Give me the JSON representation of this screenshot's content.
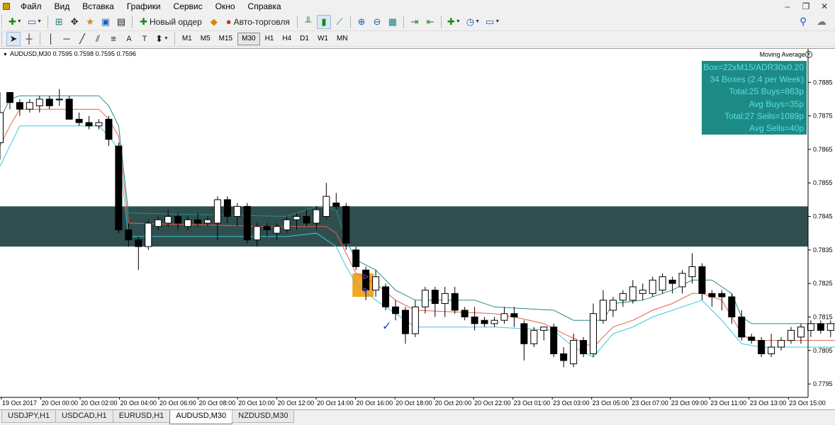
{
  "menu": {
    "items": [
      {
        "label": "Файл",
        "name": "menu-file"
      },
      {
        "label": "Вид",
        "name": "menu-view"
      },
      {
        "label": "Вставка",
        "name": "menu-insert"
      },
      {
        "label": "Графики",
        "name": "menu-charts"
      },
      {
        "label": "Сервис",
        "name": "menu-tools"
      },
      {
        "label": "Окно",
        "name": "menu-window"
      },
      {
        "label": "Справка",
        "name": "menu-help"
      }
    ],
    "window_controls": {
      "minimize": "–",
      "restore": "❐",
      "close": "✕"
    }
  },
  "toolbar": {
    "new_order_label": "Новый ордер",
    "autotrading_label": "Авто-торговля",
    "timeframes": [
      "M1",
      "M5",
      "M15",
      "M30",
      "H1",
      "H4",
      "D1",
      "W1",
      "MN"
    ],
    "active_timeframe": "M30",
    "icons": {
      "new_chart": "new-chart-icon",
      "profiles": "profiles-icon",
      "market_watch": "market-watch-icon",
      "data_window": "data-window-icon",
      "navigator": "navigator-icon",
      "terminal": "terminal-icon",
      "tester": "strategy-tester-icon",
      "bar_chart": "bar-chart-icon",
      "candles": "candlestick-chart-icon",
      "line_chart": "line-chart-icon",
      "zoom_in": "zoom-in-icon",
      "zoom_out": "zoom-out-icon",
      "tile": "tile-windows-icon",
      "autoscroll": "autoscroll-icon",
      "shift": "chart-shift-icon",
      "indicators": "indicators-icon",
      "periods": "periods-clock-icon",
      "templates": "templates-icon",
      "cursor": "cursor-icon",
      "crosshair": "crosshair-icon",
      "vline": "vertical-line-icon",
      "hline": "horizontal-line-icon",
      "trendline": "trendline-icon",
      "equidistant": "equidistant-channel-icon",
      "fibo": "fibonacci-icon",
      "text": "text-icon",
      "label": "text-label-icon",
      "arrows": "arrows-icon",
      "search": "search-icon",
      "community": "community-icon"
    }
  },
  "chart": {
    "symbol_info": "AUDUSD,M30  0.7595 0.7598 0.7595 0.7596",
    "indicator_name": "Moving Average",
    "stats": [
      "Box=22xM15/ADR30x0.20",
      "34 Boxes (2.4 per Week)",
      "Total:25 Buys=863p",
      "Avg Buys=35p",
      "Total:27 Sells=1089p",
      "Avg Sells=40p"
    ],
    "price_labels": [
      "0.7885",
      "0.7875",
      "0.7865",
      "0.7855",
      "0.7845",
      "0.7835",
      "0.7825",
      "0.7815",
      "0.7805",
      "0.7795"
    ],
    "time_labels": [
      "19 Oct 2017",
      "20 Oct 00:00",
      "20 Oct 02:00",
      "20 Oct 04:00",
      "20 Oct 06:00",
      "20 Oct 08:00",
      "20 Oct 10:00",
      "20 Oct 12:00",
      "20 Oct 14:00",
      "20 Oct 16:00",
      "20 Oct 18:00",
      "20 Oct 20:00",
      "20 Oct 22:00",
      "23 Oct 01:00",
      "23 Oct 03:00",
      "23 Oct 05:00",
      "23 Oct 07:00",
      "23 Oct 09:00",
      "23 Oct 11:00",
      "23 Oct 13:00",
      "23 Oct 15:00"
    ],
    "colors": {
      "background": "#ffffff",
      "box_fill": "#2f4f4f",
      "bear_candle": "#000000",
      "bull_candle": "#ffffff",
      "ma_mid": "#e8604a",
      "ma_upper": "#2a8a8a",
      "ma_lower": "#3cc8d8",
      "signal_box": "#f5a623",
      "checkmark": "#1a3fd0",
      "stats_bg": "#1e8a86",
      "stats_text": "#55e0e4"
    }
  },
  "chart_data": {
    "type": "candlestick",
    "series_kind": "ohlc",
    "yrange": [
      0.7791,
      0.7895
    ],
    "box": {
      "low": 0.7836,
      "high": 0.7848
    },
    "candles": [
      [
        0.7867,
        0.7882,
        0.7862,
        0.7876
      ],
      [
        0.7882,
        0.7882,
        0.7877,
        0.7879
      ],
      [
        0.7879,
        0.788,
        0.7875,
        0.7877
      ],
      [
        0.7877,
        0.788,
        0.7876,
        0.7879
      ],
      [
        0.7878,
        0.7881,
        0.7876,
        0.788
      ],
      [
        0.788,
        0.7881,
        0.7877,
        0.7878
      ],
      [
        0.788,
        0.7883,
        0.7878,
        0.788
      ],
      [
        0.788,
        0.7881,
        0.7874,
        0.7874
      ],
      [
        0.7874,
        0.7876,
        0.7872,
        0.7873
      ],
      [
        0.7873,
        0.7875,
        0.7871,
        0.7872
      ],
      [
        0.7872,
        0.7874,
        0.7871,
        0.7873
      ],
      [
        0.7874,
        0.7875,
        0.7866,
        0.7868
      ],
      [
        0.7866,
        0.7867,
        0.784,
        0.7841
      ],
      [
        0.7841,
        0.7843,
        0.7836,
        0.7838
      ],
      [
        0.7838,
        0.7839,
        0.7829,
        0.7836
      ],
      [
        0.7836,
        0.7844,
        0.7835,
        0.7843
      ],
      [
        0.7842,
        0.7845,
        0.7841,
        0.7844
      ],
      [
        0.7843,
        0.7847,
        0.7842,
        0.7845
      ],
      [
        0.7845,
        0.7846,
        0.7841,
        0.7843
      ],
      [
        0.7842,
        0.7845,
        0.7841,
        0.7844
      ],
      [
        0.7844,
        0.7846,
        0.7842,
        0.7843
      ],
      [
        0.7843,
        0.7845,
        0.7842,
        0.7844
      ],
      [
        0.7843,
        0.7851,
        0.7838,
        0.785
      ],
      [
        0.785,
        0.7851,
        0.7843,
        0.7845
      ],
      [
        0.7845,
        0.7849,
        0.7842,
        0.7848
      ],
      [
        0.7848,
        0.7849,
        0.7837,
        0.7838
      ],
      [
        0.7838,
        0.7843,
        0.7836,
        0.7842
      ],
      [
        0.7842,
        0.7843,
        0.7839,
        0.7841
      ],
      [
        0.784,
        0.7843,
        0.7838,
        0.7842
      ],
      [
        0.7841,
        0.7845,
        0.784,
        0.7844
      ],
      [
        0.7844,
        0.7846,
        0.7841,
        0.7845
      ],
      [
        0.7845,
        0.7847,
        0.7842,
        0.7843
      ],
      [
        0.7843,
        0.7848,
        0.7841,
        0.7847
      ],
      [
        0.7845,
        0.7855,
        0.7844,
        0.7851
      ],
      [
        0.7849,
        0.7852,
        0.7847,
        0.7848
      ],
      [
        0.7848,
        0.7849,
        0.7835,
        0.7837
      ],
      [
        0.7835,
        0.7836,
        0.7829,
        0.783
      ],
      [
        0.7829,
        0.783,
        0.782,
        0.7823
      ],
      [
        0.7823,
        0.7829,
        0.7821,
        0.7827
      ],
      [
        0.7824,
        0.7825,
        0.7817,
        0.7818
      ],
      [
        0.7818,
        0.782,
        0.7814,
        0.7816
      ],
      [
        0.7817,
        0.7818,
        0.7807,
        0.781
      ],
      [
        0.781,
        0.782,
        0.7809,
        0.7818
      ],
      [
        0.7818,
        0.7824,
        0.7816,
        0.7823
      ],
      [
        0.7823,
        0.7824,
        0.7815,
        0.7819
      ],
      [
        0.7819,
        0.7824,
        0.7815,
        0.7822
      ],
      [
        0.7822,
        0.7824,
        0.7816,
        0.7817
      ],
      [
        0.7817,
        0.7818,
        0.7814,
        0.7815
      ],
      [
        0.7815,
        0.7818,
        0.7811,
        0.7813
      ],
      [
        0.7814,
        0.7815,
        0.7812,
        0.7813
      ],
      [
        0.7813,
        0.7815,
        0.7812,
        0.7814
      ],
      [
        0.7814,
        0.7818,
        0.7813,
        0.7816
      ],
      [
        0.7816,
        0.7818,
        0.7812,
        0.7815
      ],
      [
        0.7813,
        0.7814,
        0.7802,
        0.7807
      ],
      [
        0.7807,
        0.7812,
        0.7806,
        0.7811
      ],
      [
        0.7811,
        0.7812,
        0.7808,
        0.7812
      ],
      [
        0.7812,
        0.7813,
        0.7803,
        0.7804
      ],
      [
        0.7804,
        0.7806,
        0.78,
        0.7802
      ],
      [
        0.7801,
        0.781,
        0.78,
        0.7808
      ],
      [
        0.7808,
        0.7809,
        0.7803,
        0.7804
      ],
      [
        0.7804,
        0.7819,
        0.7803,
        0.7816
      ],
      [
        0.7814,
        0.7823,
        0.7813,
        0.782
      ],
      [
        0.7817,
        0.7821,
        0.7815,
        0.782
      ],
      [
        0.782,
        0.7823,
        0.7818,
        0.7822
      ],
      [
        0.782,
        0.7826,
        0.7819,
        0.7824
      ],
      [
        0.7822,
        0.7825,
        0.782,
        0.7823
      ],
      [
        0.7822,
        0.7827,
        0.7821,
        0.7826
      ],
      [
        0.7823,
        0.7828,
        0.7822,
        0.7827
      ],
      [
        0.7826,
        0.7827,
        0.7822,
        0.7825
      ],
      [
        0.7824,
        0.7829,
        0.7822,
        0.7828
      ],
      [
        0.7827,
        0.7834,
        0.7825,
        0.783
      ],
      [
        0.783,
        0.7831,
        0.782,
        0.7822
      ],
      [
        0.7822,
        0.7823,
        0.7818,
        0.7821
      ],
      [
        0.7822,
        0.7823,
        0.7817,
        0.7821
      ],
      [
        0.7821,
        0.7822,
        0.7813,
        0.7815
      ],
      [
        0.7815,
        0.7817,
        0.7808,
        0.7809
      ],
      [
        0.7809,
        0.781,
        0.7807,
        0.7808
      ],
      [
        0.7808,
        0.7809,
        0.7803,
        0.7804
      ],
      [
        0.7804,
        0.781,
        0.7803,
        0.7806
      ],
      [
        0.7806,
        0.7809,
        0.7805,
        0.7808
      ],
      [
        0.7808,
        0.7812,
        0.7807,
        0.7811
      ],
      [
        0.7809,
        0.7813,
        0.7807,
        0.7812
      ],
      [
        0.7811,
        0.7814,
        0.7809,
        0.7813
      ],
      [
        0.7813,
        0.7814,
        0.781,
        0.7811
      ],
      [
        0.7811,
        0.7814,
        0.7809,
        0.7813
      ],
      [
        0.7812,
        0.7814,
        0.7807,
        0.781
      ],
      [
        0.781,
        0.7811,
        0.7804,
        0.7806
      ],
      [
        0.7805,
        0.7808,
        0.7803,
        0.7806
      ]
    ],
    "ma_mid": [
      [
        0,
        0.7866
      ],
      [
        1,
        0.7872
      ],
      [
        2,
        0.7877
      ],
      [
        10,
        0.7877
      ],
      [
        11,
        0.7874
      ],
      [
        12,
        0.7869
      ],
      [
        13,
        0.7843
      ],
      [
        27,
        0.7842
      ],
      [
        33,
        0.7842
      ],
      [
        34,
        0.784
      ],
      [
        35,
        0.7834
      ],
      [
        36,
        0.7828
      ],
      [
        38,
        0.7825
      ],
      [
        40,
        0.782
      ],
      [
        42,
        0.7817
      ],
      [
        50,
        0.7816
      ],
      [
        52,
        0.7815
      ],
      [
        55,
        0.7813
      ],
      [
        57,
        0.781
      ],
      [
        60,
        0.7806
      ],
      [
        62,
        0.7812
      ],
      [
        64,
        0.7814
      ],
      [
        66,
        0.7817
      ],
      [
        68,
        0.7819
      ],
      [
        70,
        0.7822
      ],
      [
        71,
        0.7822
      ],
      [
        73,
        0.782
      ],
      [
        74,
        0.7815
      ],
      [
        75,
        0.781
      ],
      [
        76,
        0.7808
      ],
      [
        86,
        0.7808
      ]
    ],
    "ma_upper": [
      [
        0,
        0.7874
      ],
      [
        1,
        0.788
      ],
      [
        2,
        0.7881
      ],
      [
        10,
        0.7881
      ],
      [
        11,
        0.7878
      ],
      [
        12,
        0.7872
      ],
      [
        13,
        0.7846
      ],
      [
        29,
        0.7845
      ],
      [
        32,
        0.7848
      ],
      [
        34,
        0.7847
      ],
      [
        35,
        0.7838
      ],
      [
        36,
        0.7832
      ],
      [
        38,
        0.7829
      ],
      [
        40,
        0.7823
      ],
      [
        42,
        0.782
      ],
      [
        48,
        0.782
      ],
      [
        50,
        0.7818
      ],
      [
        56,
        0.7817
      ],
      [
        58,
        0.7814
      ],
      [
        61,
        0.7814
      ],
      [
        62,
        0.7819
      ],
      [
        65,
        0.782
      ],
      [
        68,
        0.7823
      ],
      [
        70,
        0.7826
      ],
      [
        72,
        0.7826
      ],
      [
        74,
        0.7822
      ],
      [
        75,
        0.7815
      ],
      [
        76,
        0.7813
      ],
      [
        86,
        0.7813
      ]
    ],
    "ma_lower": [
      [
        0,
        0.786
      ],
      [
        1,
        0.7866
      ],
      [
        2,
        0.7872
      ],
      [
        10,
        0.7872
      ],
      [
        11,
        0.7869
      ],
      [
        12,
        0.7865
      ],
      [
        13,
        0.7839
      ],
      [
        29,
        0.7839
      ],
      [
        32,
        0.784
      ],
      [
        34,
        0.7836
      ],
      [
        35,
        0.783
      ],
      [
        36,
        0.7825
      ],
      [
        38,
        0.782
      ],
      [
        40,
        0.7816
      ],
      [
        42,
        0.7812
      ],
      [
        48,
        0.7812
      ],
      [
        50,
        0.7812
      ],
      [
        56,
        0.7811
      ],
      [
        58,
        0.7806
      ],
      [
        60,
        0.7803
      ],
      [
        62,
        0.781
      ],
      [
        64,
        0.7812
      ],
      [
        66,
        0.7815
      ],
      [
        68,
        0.7817
      ],
      [
        71,
        0.782
      ],
      [
        73,
        0.7814
      ],
      [
        75,
        0.7807
      ],
      [
        77,
        0.7806
      ],
      [
        86,
        0.7806
      ]
    ],
    "signal_box": {
      "from_index": 36,
      "to_index": 38,
      "high": 0.7828,
      "low": 0.7821
    },
    "markers": [
      {
        "kind": "arrow",
        "index": 37,
        "price": 0.7827
      },
      {
        "kind": "arrow",
        "index": 37,
        "price": 0.7823
      },
      {
        "kind": "check",
        "index": 39,
        "price": 0.7812
      }
    ]
  },
  "tabs": {
    "items": [
      "USDJPY,H1",
      "USDCAD,H1",
      "EURUSD,H1",
      "AUDUSD,M30",
      "NZDUSD,M30"
    ],
    "active_index": 3
  }
}
